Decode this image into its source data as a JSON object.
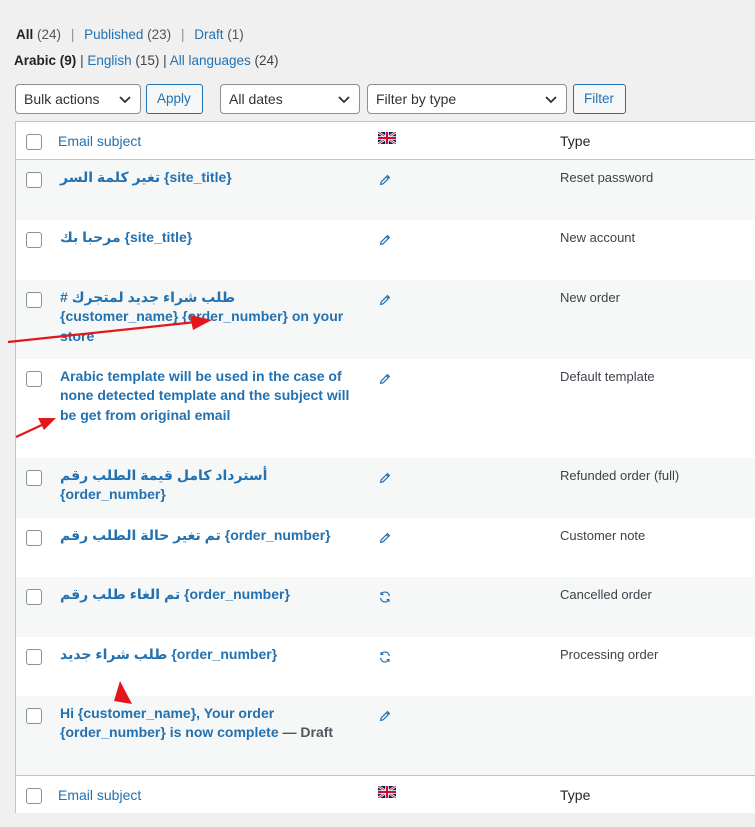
{
  "status_filters": [
    {
      "label": "All",
      "count": "(24)"
    },
    {
      "label": "Published",
      "count": "(23)"
    },
    {
      "label": "Draft",
      "count": "(1)"
    }
  ],
  "language_filters": [
    {
      "label": "Arabic",
      "count": "(9)"
    },
    {
      "label": "English",
      "count": "(15)"
    },
    {
      "label": "All languages",
      "count": "(24)"
    }
  ],
  "toolbar": {
    "bulk_actions": "Bulk actions",
    "apply": "Apply",
    "dates": "All dates",
    "type_filter": "Filter by type",
    "filter": "Filter"
  },
  "columns": {
    "subject": "Email subject",
    "type": "Type",
    "flag_icon": "uk-flag-icon"
  },
  "rows": [
    {
      "subject": "تغير كلمة السر {site_title}",
      "type": "Reset password",
      "icon": "pencil-icon"
    },
    {
      "subject": "مرحبا بك {site_title}",
      "type": "New account",
      "icon": "pencil-icon"
    },
    {
      "subject": "# طلب شراء جديد لمتجرك {customer_name} {order_number} on your store",
      "type": "New order",
      "icon": "pencil-icon"
    },
    {
      "subject": "Arabic template will be used in the case of none detected template and the subject will be get from original email",
      "type": "Default template",
      "icon": "pencil-icon"
    },
    {
      "subject": "أسترداد كامل قيمة الطلب رقم {order_number}",
      "type": "Refunded order (full)",
      "icon": "pencil-icon"
    },
    {
      "subject": "تم تغير حالة الطلب رقم {order_number}",
      "type": "Customer note",
      "icon": "pencil-icon"
    },
    {
      "subject": "تم الغاء طلب رقم {order_number}",
      "type": "Cancelled order",
      "icon": "sync-icon"
    },
    {
      "subject": "طلب شراء جديد {order_number}",
      "type": "Processing order",
      "icon": "sync-icon"
    },
    {
      "subject": "Hi {customer_name}, Your order {order_number} is now complete",
      "state": "— Draft",
      "type": "",
      "icon": "pencil-icon"
    }
  ],
  "colors": {
    "link": "#2271b1",
    "annotation_arrow": "#e3161b",
    "alt_row": "#f6f7f7"
  }
}
